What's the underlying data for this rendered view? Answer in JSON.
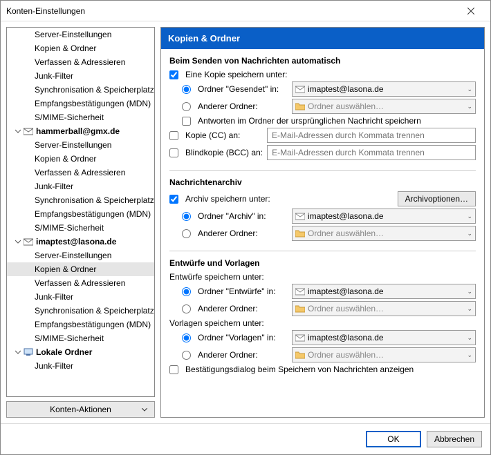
{
  "window": {
    "title": "Konten-Einstellungen",
    "close": "×"
  },
  "sidebar": {
    "items": [
      {
        "type": "sub",
        "label": "Server-Einstellungen"
      },
      {
        "type": "sub",
        "label": "Kopien & Ordner"
      },
      {
        "type": "sub",
        "label": "Verfassen & Adressieren"
      },
      {
        "type": "sub",
        "label": "Junk-Filter"
      },
      {
        "type": "sub",
        "label": "Synchronisation & Speicherplatz"
      },
      {
        "type": "sub",
        "label": "Empfangsbestätigungen (MDN)"
      },
      {
        "type": "sub",
        "label": "S/MIME-Sicherheit"
      },
      {
        "type": "account",
        "label": "hammerball@gmx.de",
        "icon": "mail"
      },
      {
        "type": "sub",
        "label": "Server-Einstellungen"
      },
      {
        "type": "sub",
        "label": "Kopien & Ordner"
      },
      {
        "type": "sub",
        "label": "Verfassen & Adressieren"
      },
      {
        "type": "sub",
        "label": "Junk-Filter"
      },
      {
        "type": "sub",
        "label": "Synchronisation & Speicherplatz"
      },
      {
        "type": "sub",
        "label": "Empfangsbestätigungen (MDN)"
      },
      {
        "type": "sub",
        "label": "S/MIME-Sicherheit"
      },
      {
        "type": "account",
        "label": "imaptest@lasona.de",
        "icon": "mail"
      },
      {
        "type": "sub",
        "label": "Server-Einstellungen"
      },
      {
        "type": "sub",
        "label": "Kopien & Ordner",
        "selected": true
      },
      {
        "type": "sub",
        "label": "Verfassen & Adressieren"
      },
      {
        "type": "sub",
        "label": "Junk-Filter"
      },
      {
        "type": "sub",
        "label": "Synchronisation & Speicherplatz"
      },
      {
        "type": "sub",
        "label": "Empfangsbestätigungen (MDN)"
      },
      {
        "type": "sub",
        "label": "S/MIME-Sicherheit"
      },
      {
        "type": "account",
        "label": "Lokale Ordner",
        "icon": "local"
      },
      {
        "type": "sub",
        "label": "Junk-Filter"
      }
    ],
    "actions_label": "Konten-Aktionen"
  },
  "panel": {
    "title": "Kopien & Ordner",
    "section1": {
      "title": "Beim Senden von Nachrichten automatisch",
      "save_copy": "Eine Kopie speichern unter:",
      "sent_folder_label": "Ordner \"Gesendet\" in:",
      "sent_value": "imaptest@lasona.de",
      "other_folder_label": "Anderer Ordner:",
      "other_placeholder": "Ordner auswählen…",
      "replies_in_orig": "Antworten im Ordner der ursprünglichen Nachricht speichern",
      "cc_label": "Kopie (CC) an:",
      "cc_placeholder": "E-Mail-Adressen durch Kommata trennen",
      "bcc_label": "Blindkopie (BCC) an:",
      "bcc_placeholder": "E-Mail-Adressen durch Kommata trennen"
    },
    "section2": {
      "title": "Nachrichtenarchiv",
      "archive_save": "Archiv speichern unter:",
      "archive_options": "Archivoptionen…",
      "archive_folder_label": "Ordner \"Archiv\" in:",
      "archive_value": "imaptest@lasona.de",
      "other_folder_label": "Anderer Ordner:",
      "other_placeholder": "Ordner auswählen…"
    },
    "section3": {
      "title": "Entwürfe und Vorlagen",
      "drafts_save": "Entwürfe speichern unter:",
      "drafts_folder_label": "Ordner \"Entwürfe\" in:",
      "drafts_value": "imaptest@lasona.de",
      "drafts_other_label": "Anderer Ordner:",
      "drafts_other_placeholder": "Ordner auswählen…",
      "templates_save": "Vorlagen speichern unter:",
      "templates_folder_label": "Ordner \"Vorlagen\" in:",
      "templates_value": "imaptest@lasona.de",
      "templates_other_label": "Anderer Ordner:",
      "templates_other_placeholder": "Ordner auswählen…",
      "confirm_save": "Bestätigungsdialog beim Speichern von Nachrichten anzeigen"
    }
  },
  "footer": {
    "ok": "OK",
    "cancel": "Abbrechen"
  }
}
